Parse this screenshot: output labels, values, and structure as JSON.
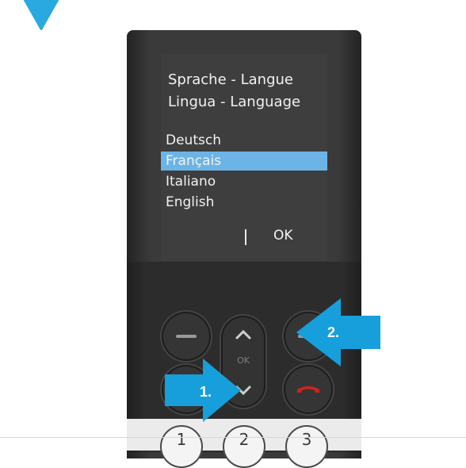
{
  "screen": {
    "title_line1": "Sprache - Langue",
    "title_line2": "Lingua - Language",
    "languages": [
      "Deutsch",
      "Français",
      "Italiano",
      "English"
    ],
    "selected_index": 1,
    "softkey_right": "OK"
  },
  "nav": {
    "center_label": "OK"
  },
  "keypad": {
    "keys": [
      "1",
      "2",
      "3"
    ]
  },
  "callouts": {
    "step1": "1.",
    "step2": "2."
  },
  "colors": {
    "accent_blue": "#169fdb",
    "selection_blue": "#6cb4e6",
    "hangup_red": "#d3221b"
  }
}
